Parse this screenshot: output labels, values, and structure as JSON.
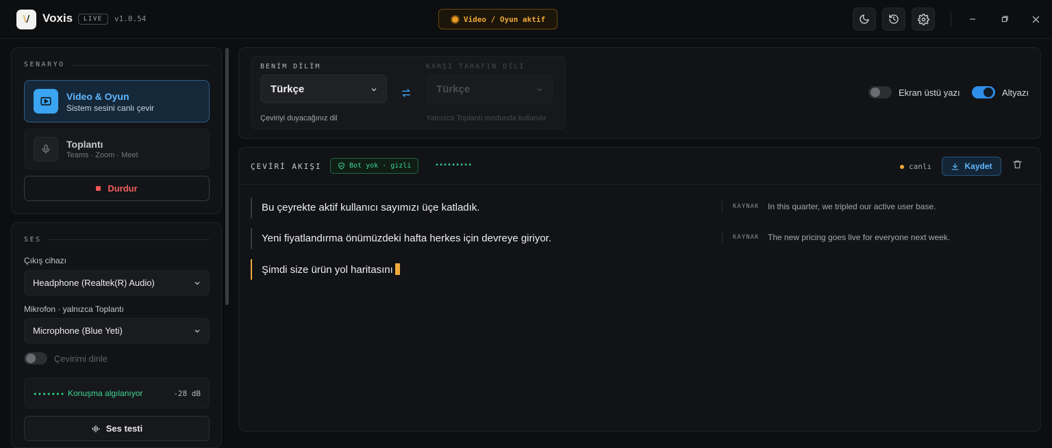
{
  "app": {
    "name": "Voxis",
    "badge": "LIVE",
    "version": "v1.0.54",
    "mode_pill": "Video / Oyun aktif"
  },
  "colors": {
    "accent_blue": "#3ba5f2",
    "accent_orange": "#f0a93a",
    "accent_green": "#3fd694",
    "danger_red": "#f06060"
  },
  "toolbar": {
    "icons": [
      "moon-icon",
      "history-icon",
      "settings-icon"
    ],
    "window": [
      "minimize-icon",
      "restore-icon",
      "close-icon"
    ]
  },
  "sidebar": {
    "scenario": {
      "label": "SENARYO",
      "items": [
        {
          "title": "Video & Oyun",
          "subtitle": "Sistem sesini canlı çevir",
          "icon": "play-screen-icon",
          "active": true
        },
        {
          "title": "Toplantı",
          "subtitle": "Teams · Zoom · Meet",
          "icon": "microphone-icon",
          "active": false
        }
      ],
      "stop_label": "Durdur"
    },
    "audio": {
      "label": "SES",
      "output_label": "Çıkış cihazı",
      "output_value": "Headphone (Realtek(R) Audio)",
      "mic_label": "Mikrofon · yalnızca Toplantı",
      "mic_value": "Microphone (Blue Yeti)",
      "monitor_label": "Çevirimi dinle",
      "monitor_on": false,
      "vu_dots": "•••••••",
      "vu_text": "Konuşma algılanıyor",
      "vu_db": "-28 dB",
      "test_label": "Ses testi"
    }
  },
  "languages": {
    "mine_label": "BENİM DİLİM",
    "mine_value": "Türkçe",
    "mine_help": "Çeviriyi duyacağınız dil",
    "other_label": "KARŞI TARAFIN DİLİ",
    "other_value": "Türkçe",
    "other_help": "Yalnızca Toplantı modunda kullanılır"
  },
  "options": {
    "overlay_label": "Ekran üstü yazı",
    "overlay_on": false,
    "subtitle_label": "Altyazı",
    "subtitle_on": true
  },
  "stream": {
    "title": "ÇEVİRİ AKIŞI",
    "bot_badge": "Bot yok · gizli",
    "dots": "•••••••••",
    "live_label": "canlı",
    "save_label": "Kaydet",
    "source_tag": "KAYNAK",
    "lines": [
      {
        "text": "Bu çeyrekte aktif kullanıcı sayımızı üçe katladık.",
        "source": "In this quarter, we tripled our active user base.",
        "current": false
      },
      {
        "text": "Yeni fiyatlandırma önümüzdeki hafta herkes için devreye giriyor.",
        "source": "The new pricing goes live for everyone next week.",
        "current": false
      },
      {
        "text": "Şimdi size ürün yol haritasını",
        "source": "",
        "current": true
      }
    ]
  }
}
